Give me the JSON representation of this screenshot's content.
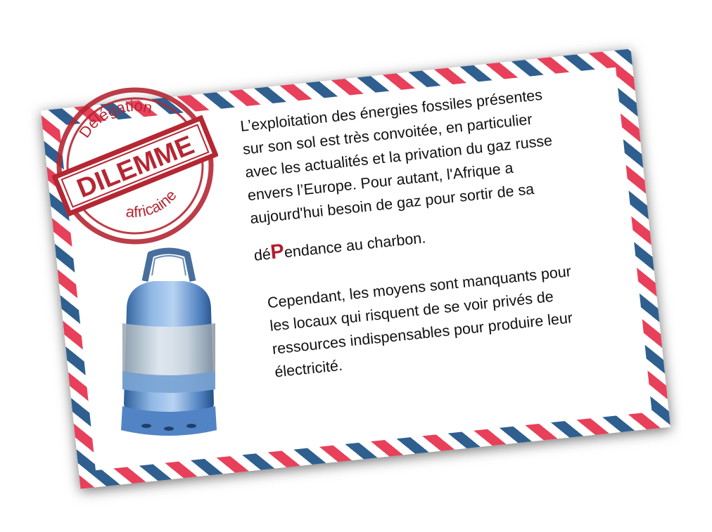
{
  "stamp": {
    "top_text": "Délégation",
    "title": "DILEMME",
    "bottom_text": "africaine",
    "color": "#b52733"
  },
  "paragraph1": {
    "lines": [
      "L’exploitation des énergies fossiles présentes",
      "sur son sol est très convoitée, en particulier",
      "avec les actualités et la privation du gaz russe",
      "envers l’Europe. Pour autant, l'Afrique a",
      "aujourd'hui besoin de gaz pour sortir de sa"
    ],
    "dep_prefix": "dé",
    "dep_highlight": "P",
    "dep_suffix": "endance au charbon."
  },
  "paragraph2": {
    "lines": [
      "Cependant, les moyens sont manquants pour",
      "les locaux qui risquent de se voir privés de",
      "ressources indispensables pour produire leur",
      "électricité."
    ]
  },
  "colors": {
    "stripe_red": "#e8405a",
    "stripe_blue": "#2f5f8f",
    "highlight": "#b01e2e",
    "cylinder_blue": "#5f8fc8"
  },
  "icons": {
    "stamp": "rubber-stamp",
    "cylinder": "gas-cylinder"
  }
}
